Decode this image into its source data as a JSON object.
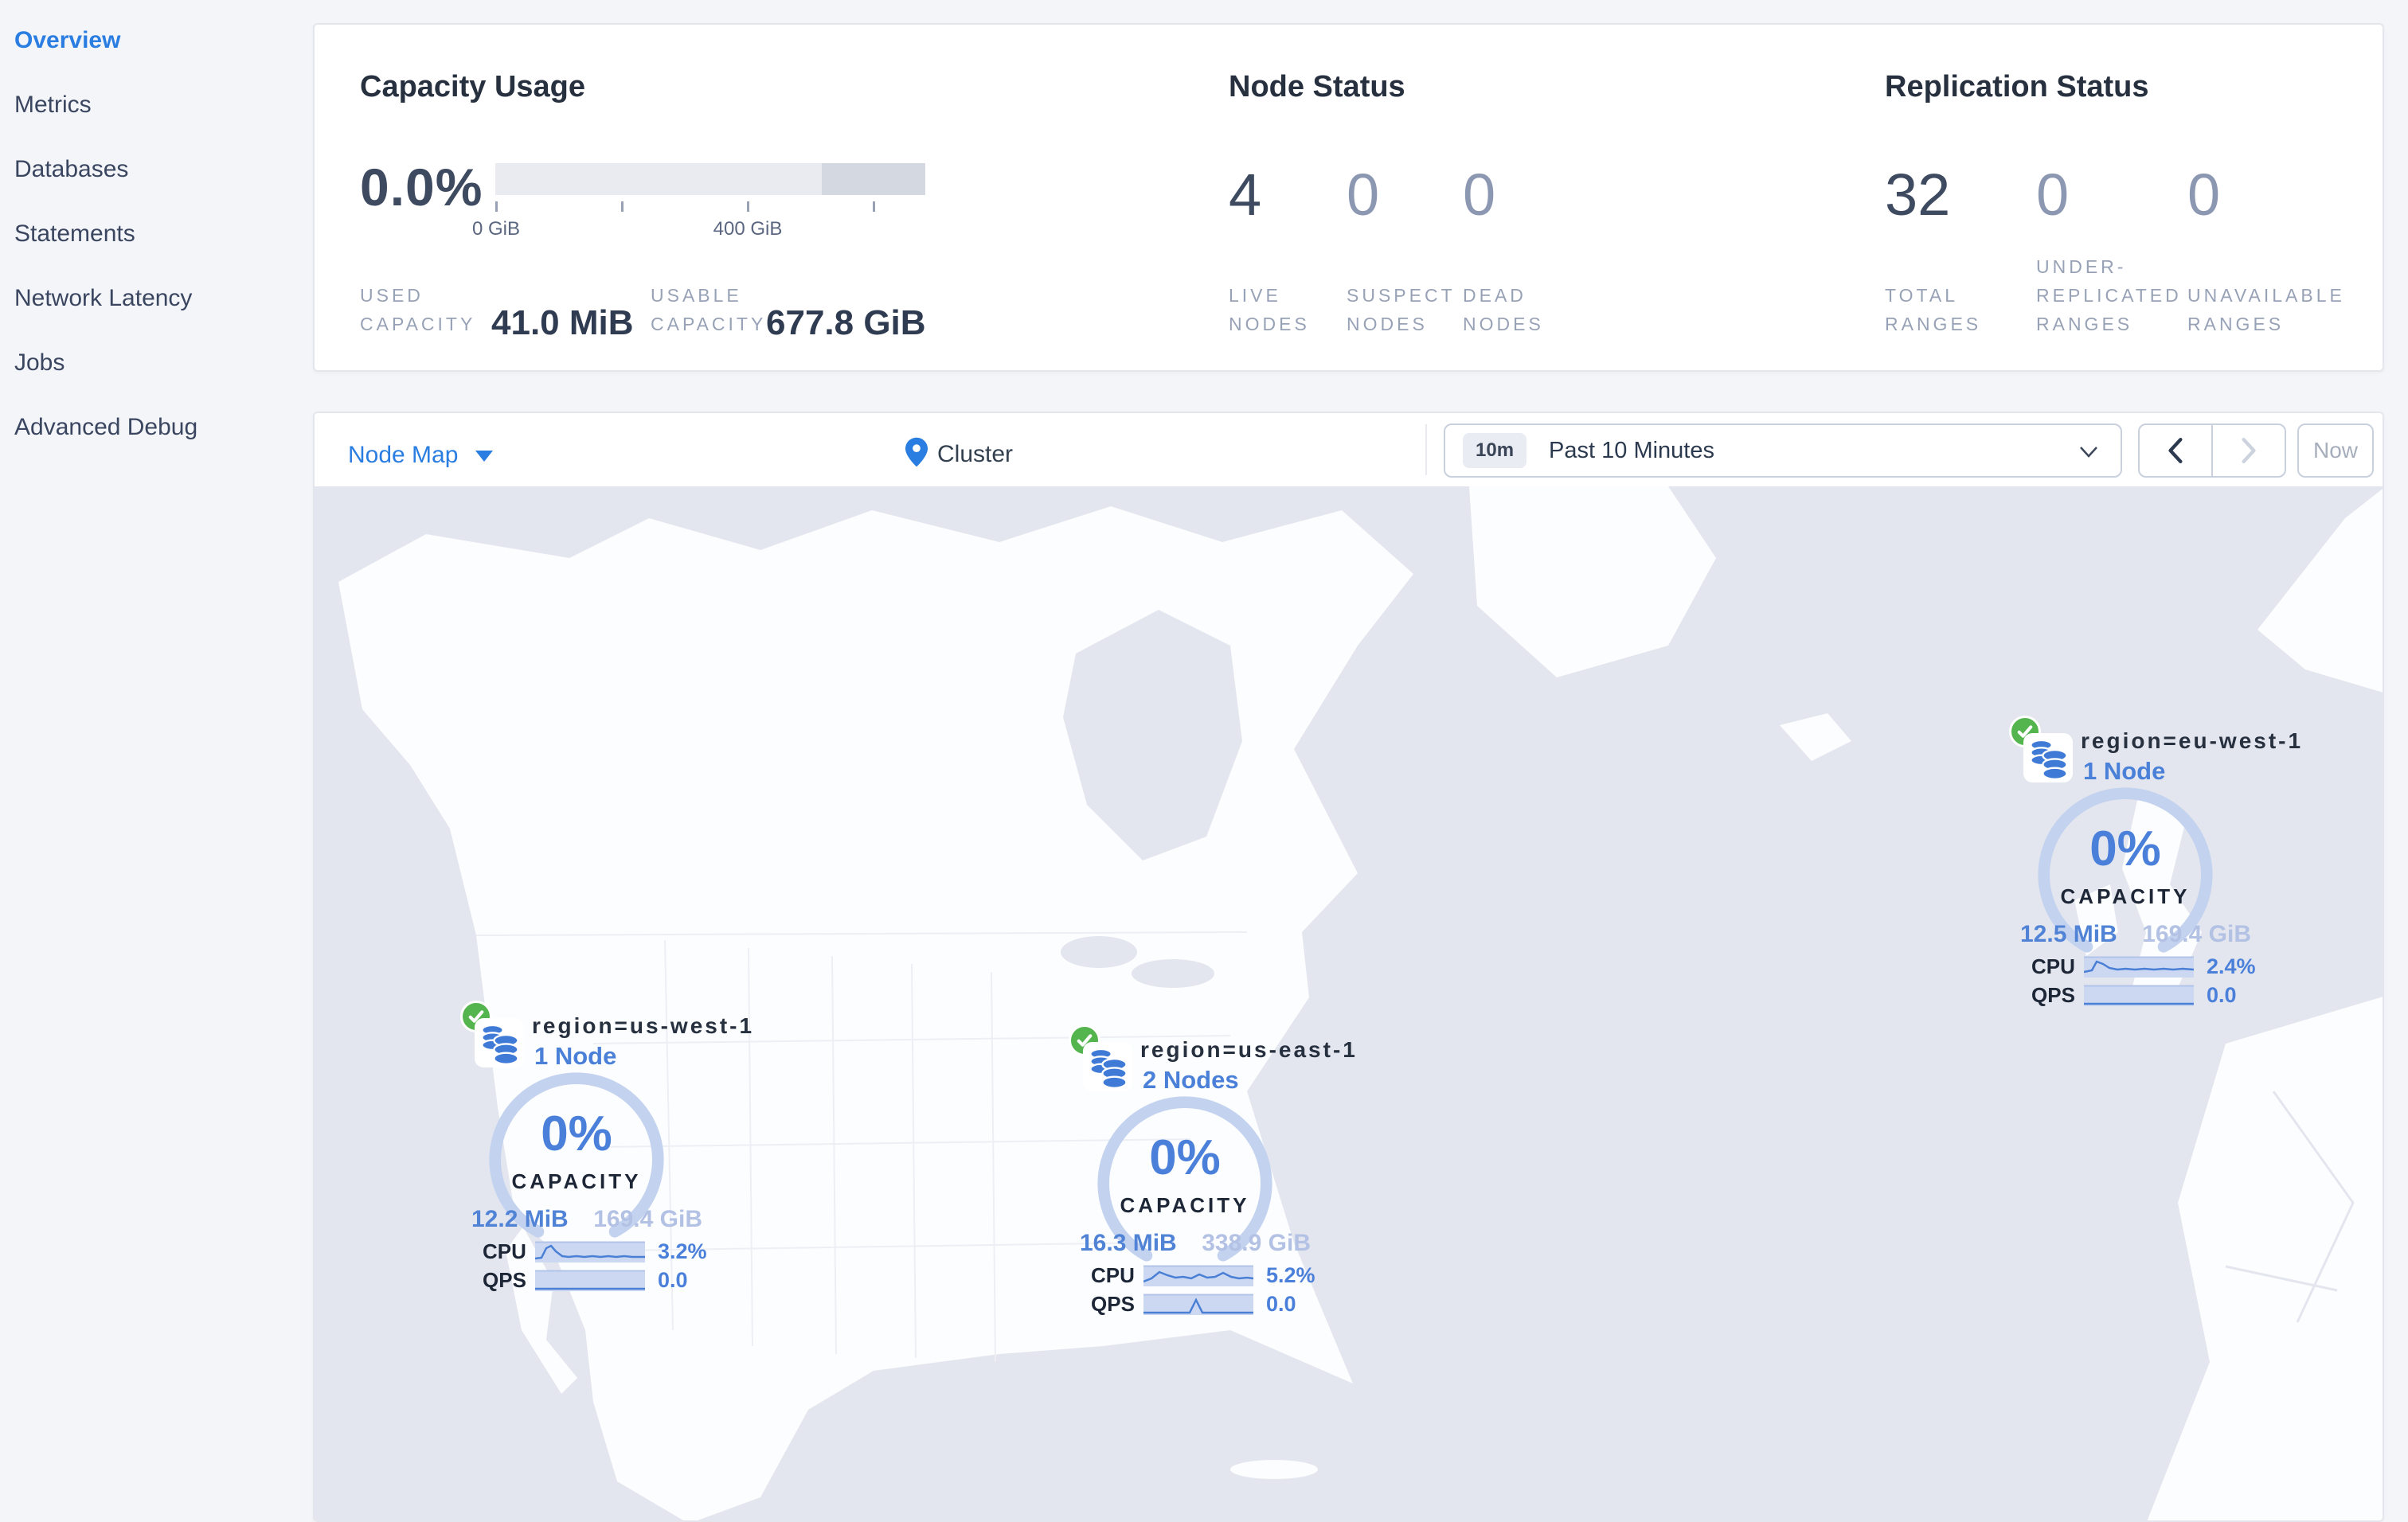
{
  "sidebar": {
    "items": [
      {
        "label": "Overview",
        "active": true
      },
      {
        "label": "Metrics",
        "active": false
      },
      {
        "label": "Databases",
        "active": false
      },
      {
        "label": "Statements",
        "active": false
      },
      {
        "label": "Network Latency",
        "active": false
      },
      {
        "label": "Jobs",
        "active": false
      },
      {
        "label": "Advanced Debug",
        "active": false
      }
    ]
  },
  "capacity": {
    "title": "Capacity Usage",
    "percent": "0.0%",
    "tick_label_0": "0 GiB",
    "tick_label_400": "400 GiB",
    "used_label_line1": "USED",
    "used_label_line2": "CAPACITY",
    "used_value": "41.0 MiB",
    "usable_label_line1": "USABLE",
    "usable_label_line2": "CAPACITY",
    "usable_value": "677.8 GiB"
  },
  "node_status": {
    "title": "Node Status",
    "stats": [
      {
        "value": "4",
        "label_line1": "LIVE",
        "label_line2": "NODES"
      },
      {
        "value": "0",
        "label_line1": "SUSPECT",
        "label_line2": "NODES"
      },
      {
        "value": "0",
        "label_line1": "DEAD",
        "label_line2": "NODES"
      }
    ]
  },
  "replication": {
    "title": "Replication Status",
    "stats": [
      {
        "value": "32",
        "label_line1": "TOTAL",
        "label_line2": "RANGES"
      },
      {
        "value": "0",
        "label_line0": "UNDER-",
        "label_line1": "REPLICATED",
        "label_line2": "RANGES"
      },
      {
        "value": "0",
        "label_line1": "UNAVAILABLE",
        "label_line2": "RANGES"
      }
    ]
  },
  "toolbar": {
    "view_selector_label": "Node Map",
    "breadcrumb_label": "Cluster",
    "time_window_badge": "10m",
    "time_window_label": "Past 10 Minutes",
    "now_label": "Now"
  },
  "markers": [
    {
      "region": "region=us-west-1",
      "nodes": "1 Node",
      "percent": "0%",
      "capacity_label": "CAPACITY",
      "used": "12.2 MiB",
      "total": "169.4 GiB",
      "cpu_label": "CPU",
      "cpu_value": "3.2%",
      "qps_label": "QPS",
      "qps_value": "0.0"
    },
    {
      "region": "region=us-east-1",
      "nodes": "2 Nodes",
      "percent": "0%",
      "capacity_label": "CAPACITY",
      "used": "16.3 MiB",
      "total": "338.9 GiB",
      "cpu_label": "CPU",
      "cpu_value": "5.2%",
      "qps_label": "QPS",
      "qps_value": "0.0"
    },
    {
      "region": "region=eu-west-1",
      "nodes": "1 Node",
      "percent": "0%",
      "capacity_label": "CAPACITY",
      "used": "12.5 MiB",
      "total": "169.4 GiB",
      "cpu_label": "CPU",
      "cpu_value": "2.4%",
      "qps_label": "QPS",
      "qps_value": "0.0"
    }
  ],
  "colors": {
    "accent_blue": "#2a7de1",
    "marker_blue": "#4b80da",
    "gauge_arc": "#c3d2ef",
    "live_green": "#54b54e",
    "dark_text": "#26303f",
    "muted_label": "#98a2b6",
    "ocean": "#e3e6ee",
    "land": "#fcfdfe"
  }
}
